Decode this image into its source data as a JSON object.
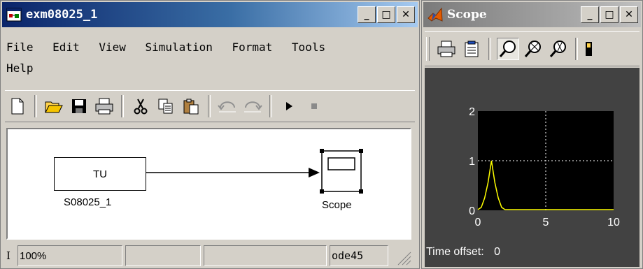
{
  "sim": {
    "title": "exm08025_1",
    "menu": [
      "File",
      "Edit",
      "View",
      "Simulation",
      "Format",
      "Tools",
      "Help"
    ],
    "toolbar_icons": [
      "new-icon",
      "open-icon",
      "save-icon",
      "print-icon",
      "cut-icon",
      "copy-icon",
      "paste-icon",
      "undo-icon",
      "redo-icon",
      "play-icon",
      "stop-icon"
    ],
    "blocks": {
      "source_text": "TU",
      "source_label": "S08025_1",
      "scope_label": "Scope"
    },
    "status": {
      "left": "I",
      "zoom": "100%",
      "solver": "ode45"
    }
  },
  "scope": {
    "title": "Scope",
    "toolbar_icons": [
      "print-icon",
      "parameters-icon",
      "zoom-icon",
      "zoom-x-icon",
      "zoom-y-icon",
      "autoscale-icon"
    ],
    "time_offset_label": "Time offset:",
    "time_offset_value": "0",
    "colors": {
      "plot_bg": "#000000",
      "trace": "#ffff00",
      "grid": "#ffffff",
      "frame_bg": "#424242"
    }
  },
  "chart_data": {
    "type": "line",
    "title": "",
    "xlabel": "",
    "ylabel": "",
    "xlim": [
      0,
      10
    ],
    "ylim": [
      0,
      2
    ],
    "xticks": [
      "0",
      "5",
      "10"
    ],
    "yticks": [
      "0",
      "1",
      "2"
    ],
    "grid": true,
    "series": [
      {
        "x": [
          0,
          0.25,
          0.5,
          0.75,
          1.0,
          1.25,
          1.5,
          1.75,
          2.0,
          10
        ],
        "y": [
          0,
          0.06,
          0.25,
          0.56,
          1.0,
          0.56,
          0.25,
          0.06,
          0,
          0
        ]
      }
    ]
  }
}
